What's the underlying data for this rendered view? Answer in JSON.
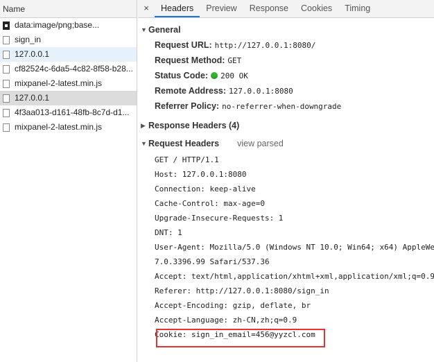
{
  "left_panel": {
    "header": "Name",
    "files": [
      {
        "name": "data:image/png;base...",
        "icon": "image-file-icon",
        "state": "normal"
      },
      {
        "name": "sign_in",
        "icon": "document-icon",
        "state": "normal"
      },
      {
        "name": "127.0.0.1",
        "icon": "document-icon",
        "state": "selected-blue"
      },
      {
        "name": "cf82524c-6da5-4c82-8f58-b28...",
        "icon": "document-icon",
        "state": "normal"
      },
      {
        "name": "mixpanel-2-latest.min.js",
        "icon": "document-icon",
        "state": "normal"
      },
      {
        "name": "127.0.0.1",
        "icon": "document-icon",
        "state": "selected-grey"
      },
      {
        "name": "4f3aa013-d161-48fb-8c7d-d1...",
        "icon": "document-icon",
        "state": "normal"
      },
      {
        "name": "mixpanel-2-latest.min.js",
        "icon": "document-icon",
        "state": "normal"
      }
    ]
  },
  "tabs": {
    "close": "×",
    "items": [
      "Headers",
      "Preview",
      "Response",
      "Cookies",
      "Timing"
    ],
    "active": "Headers"
  },
  "general": {
    "title": "General",
    "request_url_label": "Request URL:",
    "request_url": "http://127.0.0.1:8080/",
    "request_method_label": "Request Method:",
    "request_method": "GET",
    "status_code_label": "Status Code:",
    "status_code": "200 OK",
    "status_color": "#2eb82e",
    "remote_address_label": "Remote Address:",
    "remote_address": "127.0.0.1:8080",
    "referrer_policy_label": "Referrer Policy:",
    "referrer_policy": "no-referrer-when-downgrade"
  },
  "response_headers": {
    "title": "Response Headers (4)"
  },
  "request_headers": {
    "title": "Request Headers",
    "view_parsed": "view parsed",
    "lines": [
      "GET / HTTP/1.1",
      "Host: 127.0.0.1:8080",
      "Connection: keep-alive",
      "Cache-Control: max-age=0",
      "Upgrade-Insecure-Requests: 1",
      "DNT: 1",
      "User-Agent: Mozilla/5.0 (Windows NT 10.0; Win64; x64) AppleWe",
      "7.0.3396.99 Safari/537.36",
      "Accept: text/html,application/xhtml+xml,application/xml;q=0.9",
      "Referer: http://127.0.0.1:8080/sign_in",
      "Accept-Encoding: gzip, deflate, br",
      "Accept-Language: zh-CN,zh;q=0.9",
      "Cookie: sign_in_email=456@yyzcl.com"
    ]
  },
  "highlight_color": "#e33333"
}
